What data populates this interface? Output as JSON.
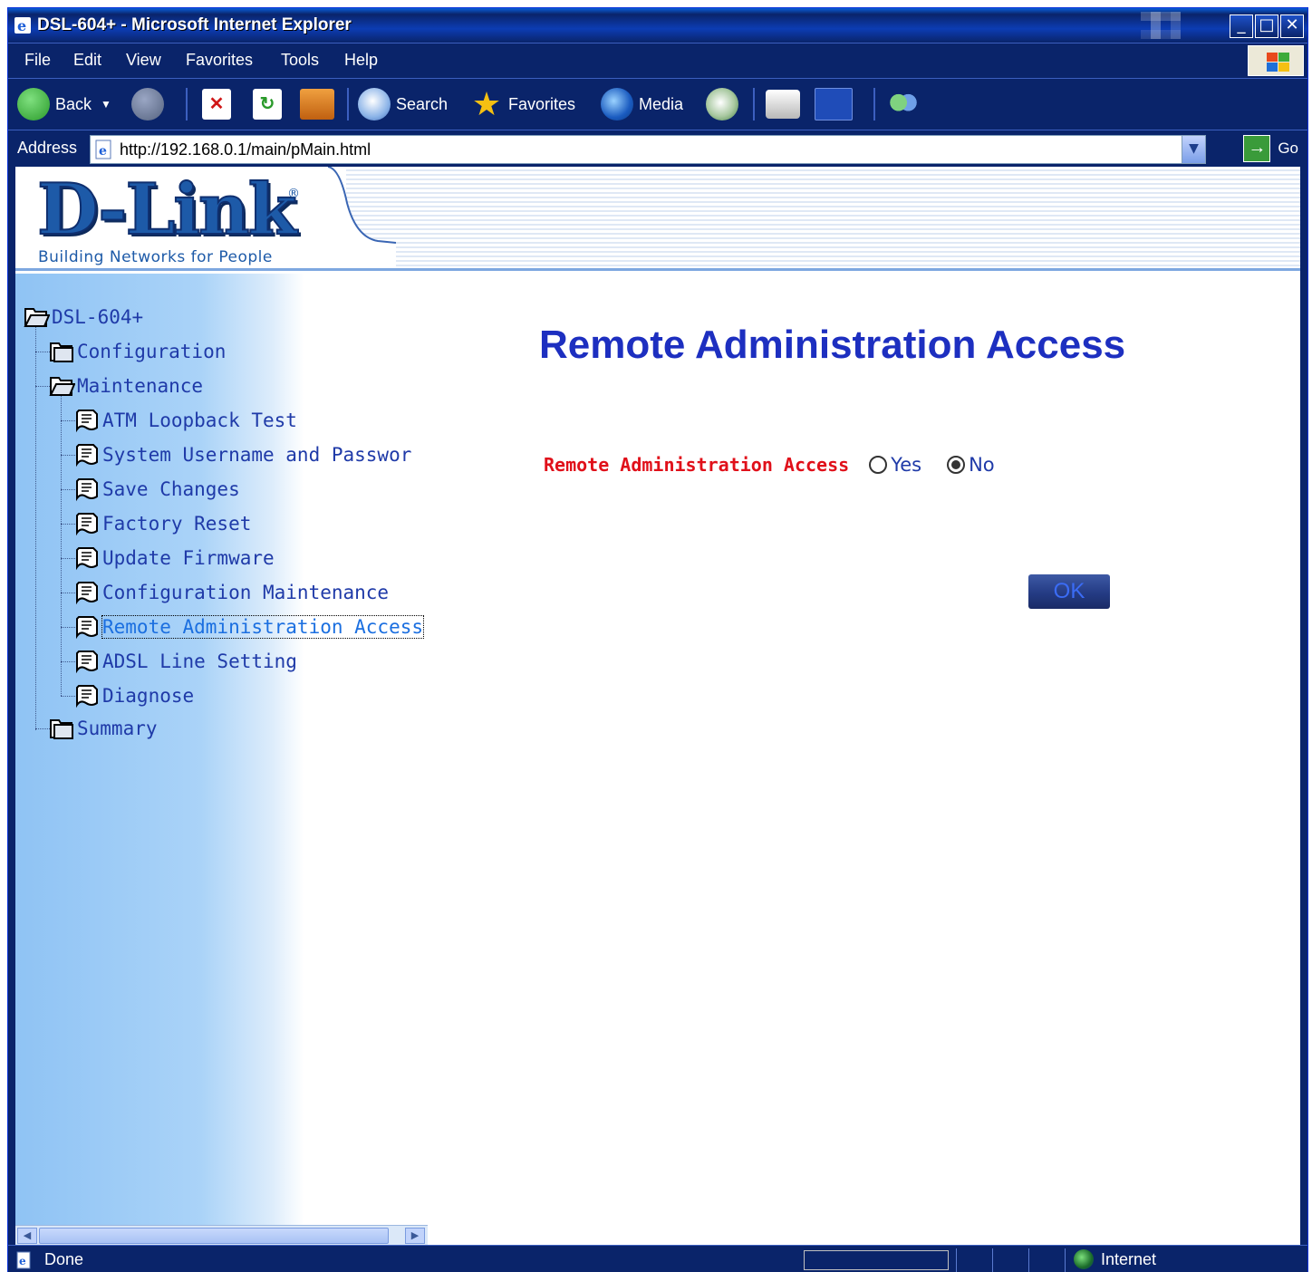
{
  "window": {
    "title": "DSL-604+ - Microsoft Internet Explorer",
    "controls": {
      "minimize": "_",
      "maximize": "□",
      "close": "✕"
    }
  },
  "menubar": {
    "items": [
      "File",
      "Edit",
      "View",
      "Favorites",
      "Tools",
      "Help"
    ]
  },
  "toolbar": {
    "back_label": "Back",
    "search_label": "Search",
    "favorites_label": "Favorites",
    "media_label": "Media"
  },
  "addressbar": {
    "label": "Address",
    "url": "http://192.168.0.1/main/pMain.html",
    "go_label": "Go"
  },
  "banner": {
    "logo": "D-Link",
    "registered": "®",
    "tagline": "Building Networks for People"
  },
  "sidebar": {
    "root": "DSL-604+",
    "configuration": "Configuration",
    "maintenance": "Maintenance",
    "items": [
      "ATM Loopback Test",
      "System Username and Passwor",
      "Save Changes",
      "Factory Reset",
      "Update Firmware",
      "Configuration Maintenance",
      "Remote Administration Access",
      "ADSL Line Setting",
      "Diagnose"
    ],
    "active_item": "Remote Administration Access",
    "summary": "Summary"
  },
  "main": {
    "title": "Remote Administration Access",
    "field_label": "Remote Administration Access",
    "options": [
      {
        "label": "Yes",
        "selected": false
      },
      {
        "label": "No",
        "selected": true
      }
    ],
    "ok_label": "OK"
  },
  "statusbar": {
    "status": "Done",
    "zone": "Internet"
  },
  "colors": {
    "chrome": "#0a246a",
    "title_blue": "#1d2fc0",
    "field_label_red": "#e0101a",
    "link_blue": "#1f3aa8"
  }
}
